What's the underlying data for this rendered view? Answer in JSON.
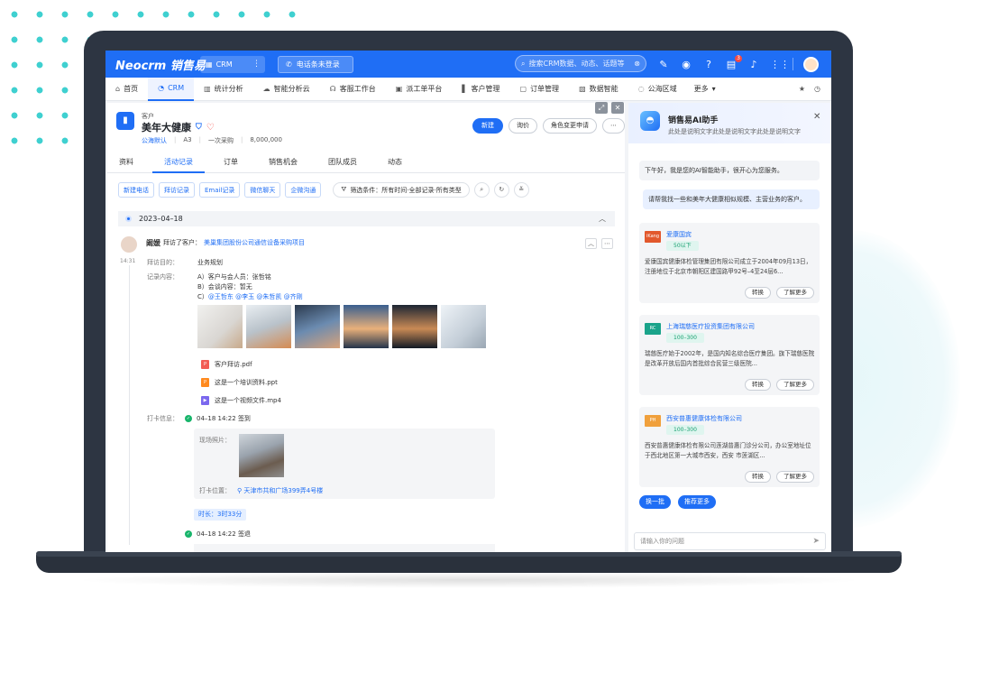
{
  "app": {
    "logo": "Neocrm 销售易"
  },
  "topbar": {
    "crm_label": "CRM",
    "phone_label": "电话条未登录",
    "search_placeholder": "搜索CRM数据、动态、话题等",
    "notification_badge": "3",
    "brand_color": "#1f6ef5"
  },
  "nav": {
    "items": [
      "首页",
      "CRM",
      "统计分析",
      "智能分析云",
      "客服工作台",
      "派工单平台",
      "客户管理",
      "订单管理",
      "数据智能",
      "公海区域"
    ],
    "more": "更多"
  },
  "header": {
    "type": "客户",
    "name": "美年大健康",
    "owner": "公海默认",
    "level": "A3",
    "purchase": "一次采购",
    "amount": "8,000,000",
    "btn_new": "新建",
    "btn_ask": "询价",
    "btn_role": "角色变更申请"
  },
  "tabs": [
    "资料",
    "活动记录",
    "订单",
    "销售机会",
    "团队成员",
    "动态"
  ],
  "actions": [
    "新建电话",
    "拜访记录",
    "Email记录",
    "微信聊天",
    "企微沟通"
  ],
  "filter": "筛选条件：所有时间·全部记录·所有类型",
  "timeline": {
    "date": "2023–04–18",
    "time": "14:31",
    "author": "阚媛",
    "verb": "拜访了客户：",
    "project": "美巢集团股份公司通信设备采购项目",
    "purpose_label": "拜访目的：",
    "purpose": "业务规划",
    "content_label": "记录内容：",
    "line_a": "A）客户与会人员：张哲铭",
    "line_b": "B）会谈内容：暂无",
    "line_c_prefix": "C）",
    "mentions": "@王哲东 @李玉 @朱哲凯 @齐刚",
    "files": [
      "客户拜访.pdf",
      "这是一个培训资料.ppt",
      "这是一个视频文件.mp4"
    ],
    "checkin_label": "打卡信息：",
    "checkin_in": "04–18 14:22 签到",
    "site_photo_label": "现场照片：",
    "location_label": "打卡位置：",
    "location": "天津市共和广场399弄4号楼",
    "duration": "时长：3时33分",
    "checkin_out": "04–18 14:22 签退"
  },
  "ai": {
    "title": "销售易AI助手",
    "subtitle": "此处是说明文字此处是说明文字此处是说明文字",
    "greeting": "下午好，我是您的AI智能助手，很开心为您服务。",
    "user_msg": "请帮我找一些和美年大健康相似规模、主营业务的客户。",
    "cards": [
      {
        "name": "爱康国宾",
        "tag": "50以下",
        "desc": "爱康国宾健康体检管理集团有限公司成立于2004年09月13日，注册地位于北京市朝阳区建国路甲92号–4至24层6..."
      },
      {
        "name": "上海瑞慈医疗投资集团有限公司",
        "tag": "100–300",
        "desc": "瑞慈医疗始于2002年，是国内知名综合医疗集团。旗下瑞慈医院是改革开放后国内首批综合民营三级医院..."
      },
      {
        "name": "西安普惠健康体检有限公司",
        "tag": "100–300",
        "desc": "西安普惠健康体检有限公司莲湖普惠门诊分公司，办公室地址位于西北地区第一大城市西安，西安 市莲湖区..."
      }
    ],
    "btn_convert": "转换",
    "btn_more": "了解更多",
    "btn_switch": "换一批",
    "btn_recommend": "推荐更多",
    "input_placeholder": "请输入你的问题"
  }
}
